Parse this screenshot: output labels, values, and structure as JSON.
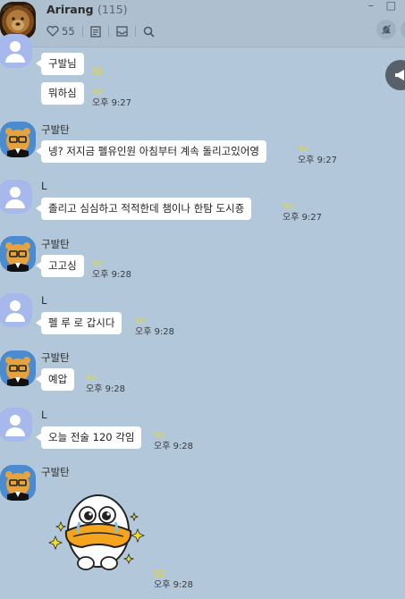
{
  "header": {
    "title": "Arirang",
    "member_count": "(115)",
    "likes": "55",
    "window_controls": [
      "–",
      "□"
    ]
  },
  "messages": [
    {
      "sender": "",
      "text": "구발님",
      "unread": "92",
      "time": ""
    },
    {
      "sender": "",
      "text": "뭐하심",
      "unread": "92",
      "time": "오후 9:27"
    },
    {
      "sender": "구발탄",
      "text": "넹? 저지금 펠유인원 아침부터 계속 돌리고있어영",
      "unread": "92",
      "time": "오후 9:27"
    },
    {
      "sender": "L",
      "text": "졸리고 심심하고 적적한데 챔이나 한탐 도시죵",
      "unread": "92",
      "time": "오후 9:27"
    },
    {
      "sender": "구발탄",
      "text": "고고싱",
      "unread": "92",
      "time": "오후 9:28"
    },
    {
      "sender": "L",
      "text": "펠 루 로 갑시다",
      "unread": "92",
      "time": "오후 9:28"
    },
    {
      "sender": "구발탄",
      "text": "예압",
      "unread": "92",
      "time": "오후 9:28"
    },
    {
      "sender": "L",
      "text": "오늘 전술 120 각임",
      "unread": "92",
      "time": "오후 9:28"
    },
    {
      "sender": "구발탄",
      "text": "",
      "unread": "92",
      "time": "오후 9:28",
      "sticker": "crying-duck-sticker"
    }
  ],
  "colors": {
    "chat_background": "#b2c7da",
    "header_background": "#aebfcf",
    "bubble": "#ffffff",
    "unread_count": "#e7d72d",
    "side_button": "#58606a",
    "user_avatar": "#a6b8ec"
  }
}
